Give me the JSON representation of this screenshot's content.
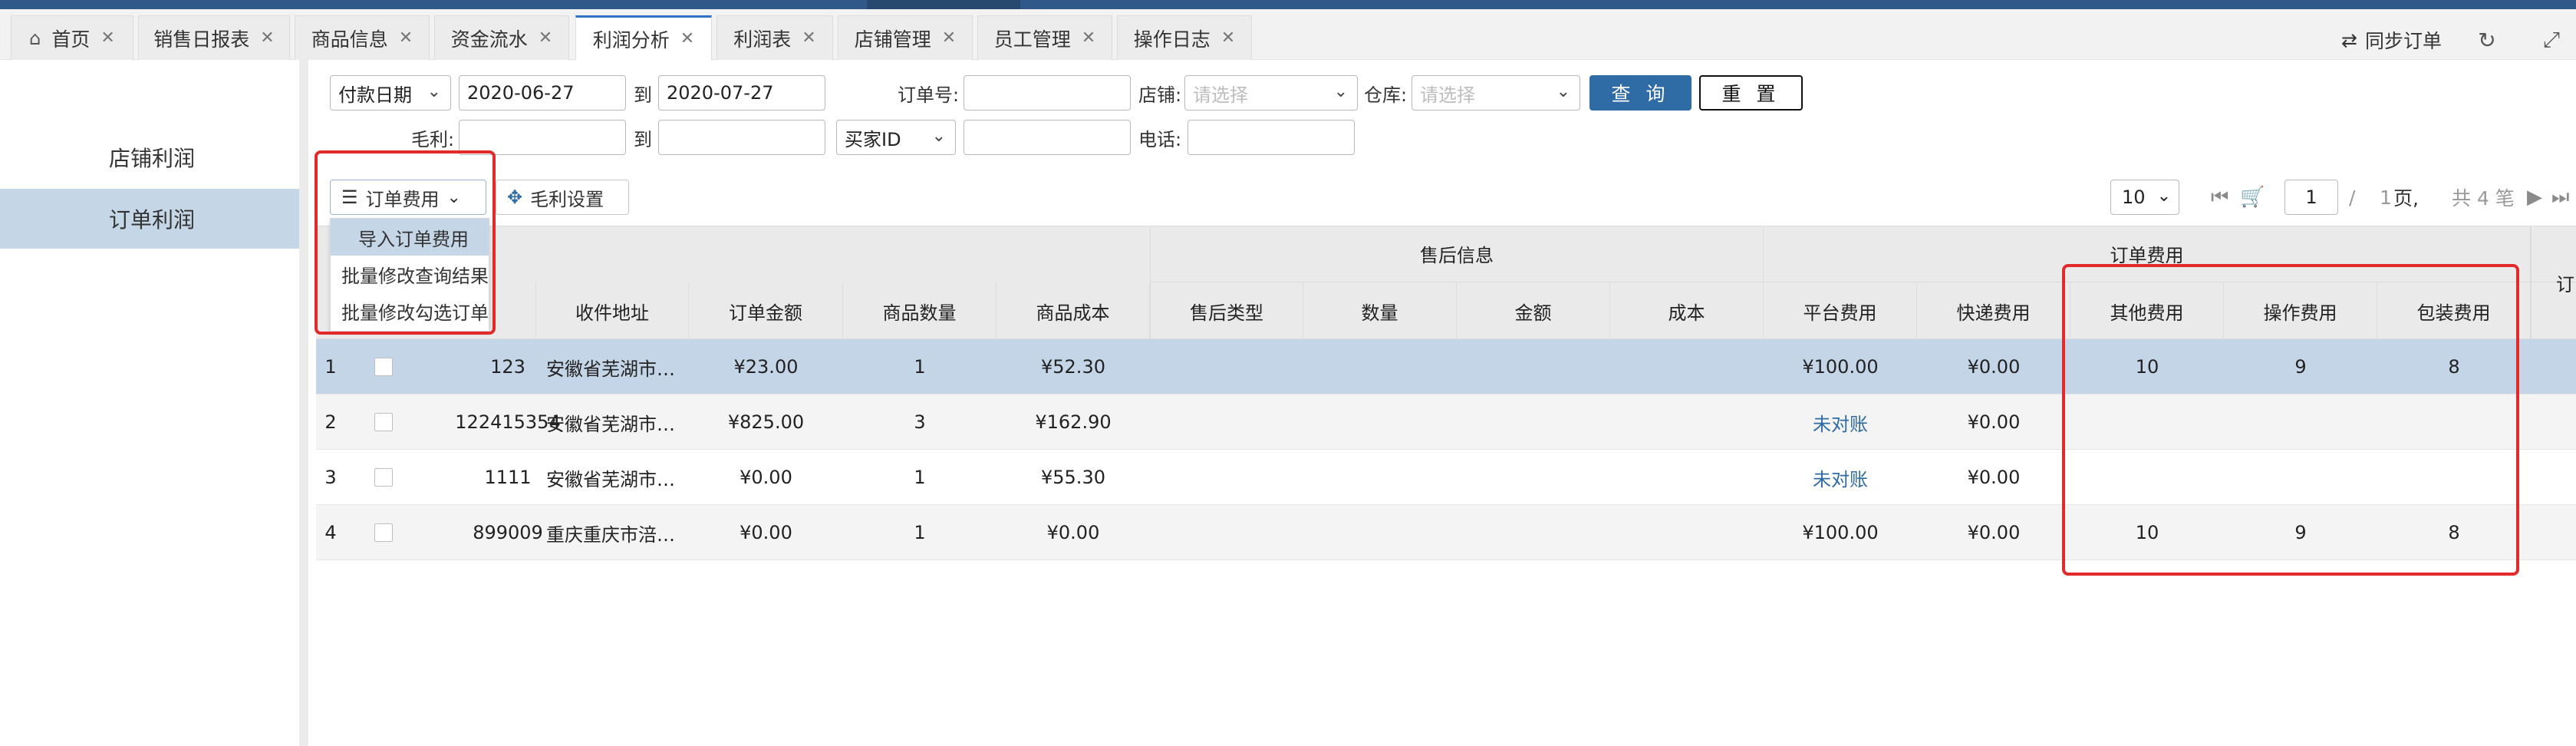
{
  "tabs": [
    {
      "label": "首页",
      "home": true
    },
    {
      "label": "销售日报表"
    },
    {
      "label": "商品信息"
    },
    {
      "label": "资金流水"
    },
    {
      "label": "利润分析",
      "active": true
    },
    {
      "label": "利润表"
    },
    {
      "label": "店铺管理"
    },
    {
      "label": "员工管理"
    },
    {
      "label": "操作日志"
    }
  ],
  "header": {
    "sync_label": "同步订单"
  },
  "sidebar": {
    "items": [
      {
        "label": "店铺利润"
      },
      {
        "label": "订单利润",
        "active": true
      }
    ]
  },
  "filters": {
    "date_type": "付款日期",
    "date_from": "2020-06-27",
    "to_label": "到",
    "date_to": "2020-07-27",
    "order_no_label": "订单号:",
    "order_no": "",
    "shop_label": "店铺:",
    "shop_placeholder": "请选择",
    "warehouse_label": "仓库:",
    "warehouse_placeholder": "请选择",
    "query_label": "查 询",
    "reset_label": "重 置",
    "profit_label": "毛利:",
    "profit_from": "",
    "profit_to": "",
    "buyer_type": "买家ID",
    "buyer_value": "",
    "phone_label": "电话:",
    "phone": ""
  },
  "toolbar": {
    "order_fee_label": "订单费用",
    "profit_settings_label": "毛利设置",
    "menu": [
      "导入订单费用",
      "批量修改查询结果",
      "批量修改勾选订单"
    ]
  },
  "pager": {
    "page_size": "10",
    "current_page": "1",
    "slash": "/",
    "total_pages": "1",
    "pages_unit": "页,",
    "total_label": "共 4 笔"
  },
  "table": {
    "groups": {
      "after_sale": "售后信息",
      "order_fees": "订单费用"
    },
    "columns": [
      "收件地址",
      "订单金额",
      "商品数量",
      "商品成本",
      "售后类型",
      "数量",
      "金额",
      "成本",
      "平台费用",
      "快递费用",
      "其他费用",
      "操作费用",
      "包装费用"
    ],
    "rows": [
      {
        "idx": "1",
        "order_no": "123",
        "address": "安徽省芜湖市…",
        "amount": "¥23.00",
        "qty": "1",
        "cost": "¥52.30",
        "platform_fee": "¥100.00",
        "express_fee": "¥0.00",
        "other_fee": "10",
        "op_fee": "9",
        "pack_fee": "8"
      },
      {
        "idx": "2",
        "order_no": "122415354",
        "address": "安徽省芜湖市…",
        "amount": "¥825.00",
        "qty": "3",
        "cost": "¥162.90",
        "platform_fee": "未对账",
        "express_fee": "¥0.00",
        "other_fee": "",
        "op_fee": "",
        "pack_fee": ""
      },
      {
        "idx": "3",
        "order_no": "1111",
        "address": "安徽省芜湖市…",
        "amount": "¥0.00",
        "qty": "1",
        "cost": "¥55.30",
        "platform_fee": "未对账",
        "express_fee": "¥0.00",
        "other_fee": "",
        "op_fee": "",
        "pack_fee": ""
      },
      {
        "idx": "4",
        "order_no": "899009",
        "address": "重庆重庆市涪…",
        "amount": "¥0.00",
        "qty": "1",
        "cost": "¥0.00",
        "platform_fee": "¥100.00",
        "express_fee": "¥0.00",
        "other_fee": "10",
        "op_fee": "9",
        "pack_fee": "8"
      }
    ],
    "cut_header_char": "订"
  },
  "colors": {
    "accent": "#2f6ba5",
    "selected_row": "#c3d5e6",
    "highlight_box": "#e22a2a",
    "topbar": "#30598a"
  },
  "icons": [
    "home-icon",
    "close-icon",
    "sync-icon",
    "refresh-icon",
    "fullscreen-icon",
    "chevron-down-icon",
    "list-icon",
    "move-icon",
    "first-page-icon",
    "cart-icon",
    "next-page-icon",
    "last-page-icon"
  ]
}
